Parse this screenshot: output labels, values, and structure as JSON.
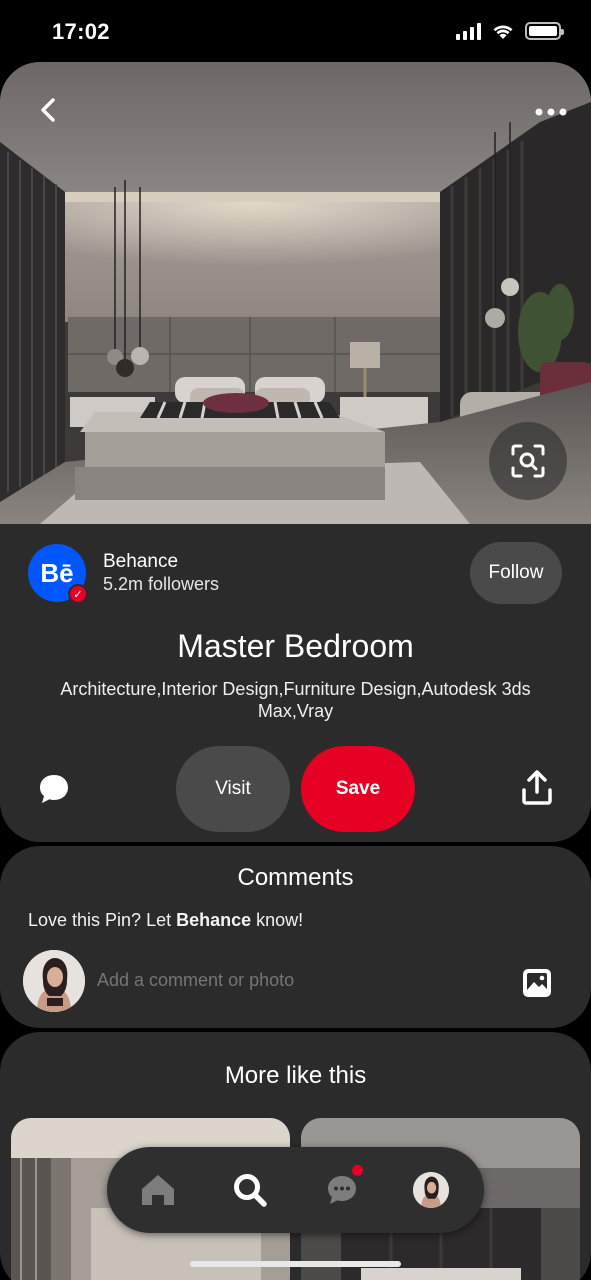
{
  "status_bar": {
    "time": "17:02"
  },
  "pin": {
    "title": "Master Bedroom",
    "description": "Architecture,Interior Design,Furniture Design,Autodesk 3ds Max,Vray"
  },
  "creator": {
    "name": "Behance",
    "followers": "5.2m followers",
    "avatar_text": "Bē",
    "follow_label": "Follow"
  },
  "actions": {
    "visit_label": "Visit",
    "save_label": "Save"
  },
  "comments": {
    "title": "Comments",
    "prompt_prefix": "Love this Pin? Let ",
    "prompt_name": "Behance",
    "prompt_suffix": " know!",
    "input_placeholder": "Add a comment or photo"
  },
  "more": {
    "title": "More like this"
  },
  "nav": {
    "items": [
      "home-icon",
      "search-icon",
      "messages-icon",
      "profile-avatar"
    ],
    "active": "search-icon",
    "messages_has_notification": true
  },
  "colors": {
    "brand_red": "#e60023",
    "behance_blue": "#0057ff",
    "card_bg": "#2b2b2b",
    "button_gray": "#4a4a4a"
  }
}
